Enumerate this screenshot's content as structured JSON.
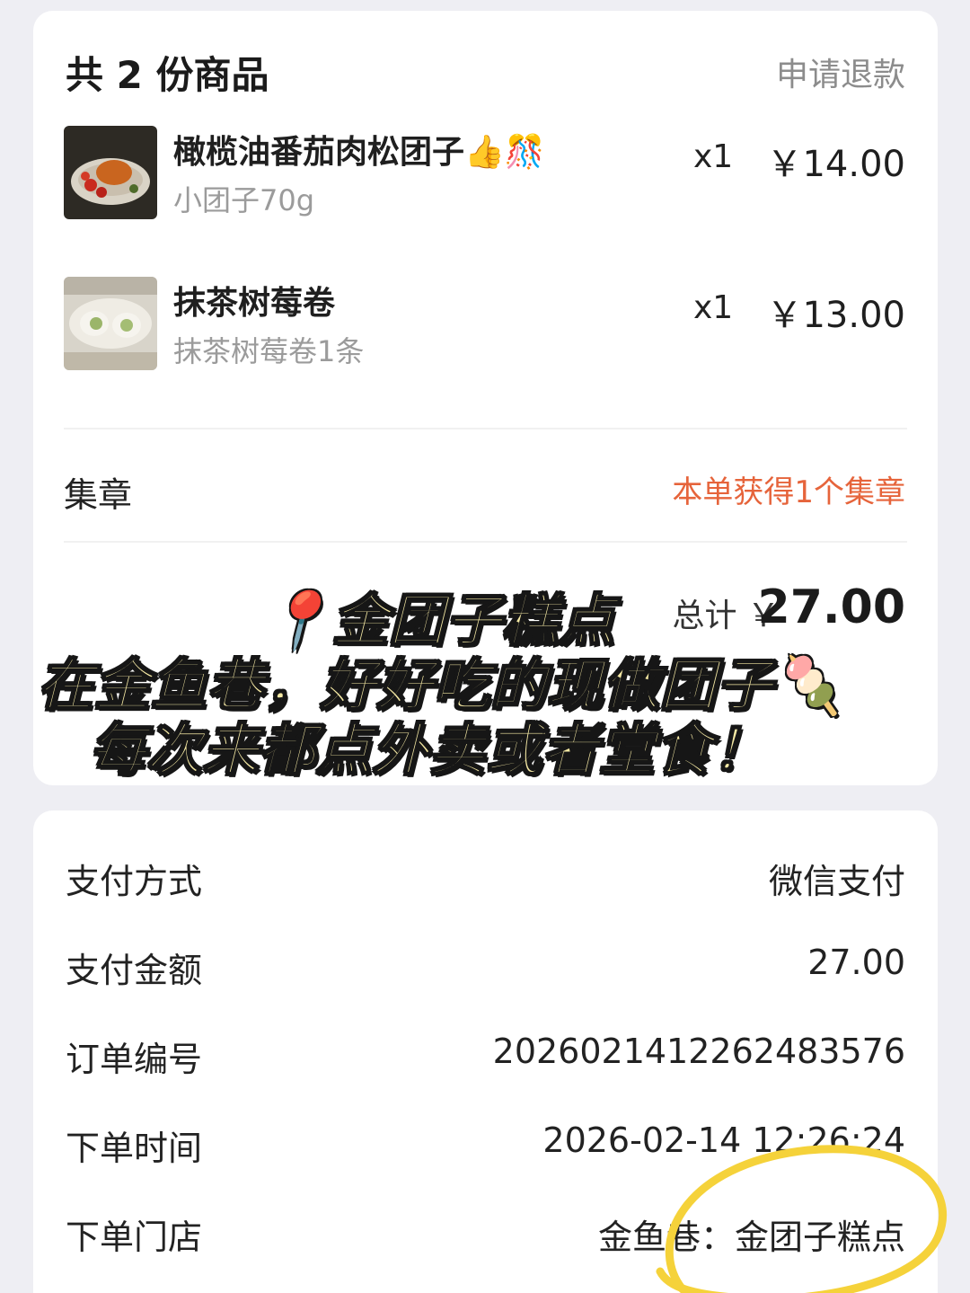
{
  "order": {
    "header_title": "共 2 份商品",
    "refund_label": "申请退款",
    "items": [
      {
        "name": "橄榄油番茄肉松团子",
        "emoji": "👍🎊",
        "spec": "小团子70g",
        "qty": "x1",
        "price": "￥14.00"
      },
      {
        "name": "抹茶树莓卷",
        "emoji": "",
        "spec": "抹茶树莓卷1条",
        "qty": "x1",
        "price": "￥13.00"
      }
    ],
    "stamp_label": "集章",
    "stamp_value": "本单获得1个集章",
    "total_label": "总计 ￥",
    "total_value": "27.00"
  },
  "payment": {
    "rows": [
      {
        "label": "支付方式",
        "value": "微信支付"
      },
      {
        "label": "支付金额",
        "value": "27.00"
      },
      {
        "label": "订单编号",
        "value": "2026021412262483576"
      },
      {
        "label": "下单时间",
        "value": "2026-02-14 12:26:24"
      },
      {
        "label": "下单门店",
        "value": "金鱼巷：金团子糕点"
      }
    ]
  },
  "caption": {
    "line1": "📍金团子糕点",
    "line2": "在金鱼巷，好好吃的现做团子🍡",
    "line3": "每次来都点外卖或者堂食！"
  },
  "colors": {
    "accent_orange": "#e6643b",
    "caption_fill": "#f5e9a4",
    "highlight_ring": "#f5d23a"
  }
}
